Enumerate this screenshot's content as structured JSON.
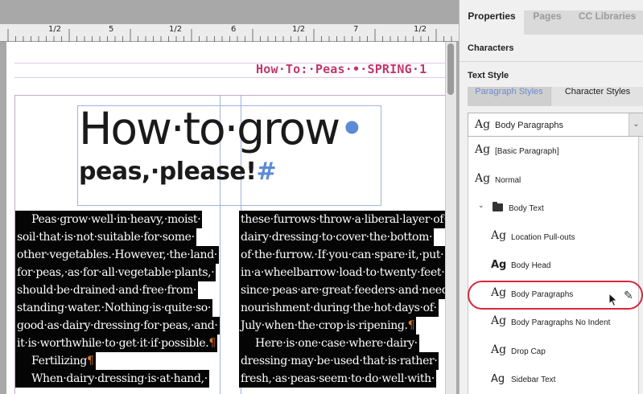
{
  "ruler": {
    "labels": [
      "1/2",
      "5",
      "1/2",
      "6",
      "1/2",
      "7",
      "1/2"
    ]
  },
  "document": {
    "running_header": "How·To:·Peas·•·SPRING·1",
    "title_line1_a": "How·to·grow",
    "title_line1_b": "•",
    "title_line2_a": "peas,·please!",
    "title_line2_b": "#",
    "col1": [
      {
        "text": "Peas·grow·well·in·heavy,·moist·",
        "indent": true
      },
      {
        "text": "soil·that·is·not·suitable·for·some·",
        "indent": false
      },
      {
        "text": "other·vegetables.·However,·the·land·",
        "indent": false
      },
      {
        "text": "for·peas,·as·for·all·vegetable·plants,·",
        "indent": false
      },
      {
        "text": "should·be·drained·and·free·from·",
        "indent": false
      },
      {
        "text": "standing·water.·Nothing·is·quite·so·",
        "indent": false
      },
      {
        "text": "good·as·dairy·dressing·for·peas,·and·",
        "indent": false
      },
      {
        "text": "it·is·worthwhile·to·get·it·if·possible.",
        "indent": false,
        "mark": "¶"
      },
      {
        "text": "Fertilizing",
        "indent": true,
        "mark": "¶"
      },
      {
        "text": "When·dairy·dressing·is·at·hand,·",
        "indent": true
      }
    ],
    "col2": [
      {
        "text": "these·furrows·throw·a·liberal·layer·of·",
        "indent": false
      },
      {
        "text": "dairy·dressing·to·cover·the·bottom·",
        "indent": false
      },
      {
        "text": "of·the·furrow.·If·you·can·spare·it,·put·",
        "indent": false
      },
      {
        "text": "in·a·wheelbarrow·load·to·twenty·feet·",
        "indent": false
      },
      {
        "text": "since·peas·are·great·feeders·and·need·",
        "indent": false
      },
      {
        "text": "nourishment·during·the·hot·days·of·",
        "indent": false
      },
      {
        "text": "July·when·the·crop·is·ripening.",
        "indent": false,
        "mark": "¶"
      },
      {
        "text": "Here·is·one·case·where·dairy·",
        "indent": true
      },
      {
        "text": "dressing·may·be·used·that·is·rather·",
        "indent": false
      },
      {
        "text": "fresh,·as·peas·seem·to·do·well·with·",
        "indent": false
      }
    ]
  },
  "panel": {
    "tabs": [
      "Properties",
      "Pages",
      "CC Libraries"
    ],
    "active_tab": "Properties",
    "characters_label": "Characters",
    "text_style_label": "Text Style",
    "subtabs": [
      "Paragraph Styles",
      "Character Styles"
    ],
    "active_subtab": "Paragraph Styles",
    "dropdown": {
      "glyph": "Ag",
      "value": "Body Paragraphs",
      "arrow": "⌄"
    },
    "styles": [
      {
        "glyph": "Ag",
        "label": "[Basic Paragraph]",
        "level": 0,
        "glyph_style": "serif"
      },
      {
        "glyph": "Ag",
        "label": "Normal",
        "level": 0,
        "glyph_style": "serif"
      },
      {
        "glyph": "",
        "label": "Body Text",
        "level": 0,
        "folder": true,
        "expanded": true
      },
      {
        "glyph": "Ag",
        "label": "Location Pull-outs",
        "level": 1,
        "glyph_style": "serif"
      },
      {
        "glyph": "Ag",
        "label": "Body Head",
        "level": 1,
        "glyph_style": "bold"
      },
      {
        "glyph": "Ag",
        "label": "Body Paragraphs",
        "level": 1,
        "glyph_style": "serif",
        "highlighted": true
      },
      {
        "glyph": "Ag",
        "label": "Body Paragraphs No Indent",
        "level": 1,
        "glyph_style": "serif"
      },
      {
        "glyph": "Ag",
        "label": "Drop Cap",
        "level": 1,
        "glyph_style": "serif"
      },
      {
        "glyph": "Ag",
        "label": "Sidebar Text",
        "level": 1,
        "glyph_style": "sans"
      }
    ],
    "pencil_icon": "✎",
    "colors": {
      "highlight_ring": "#d8263a",
      "active_subtab_text": "#6d8bd1",
      "header_magenta": "#c0376e"
    }
  }
}
